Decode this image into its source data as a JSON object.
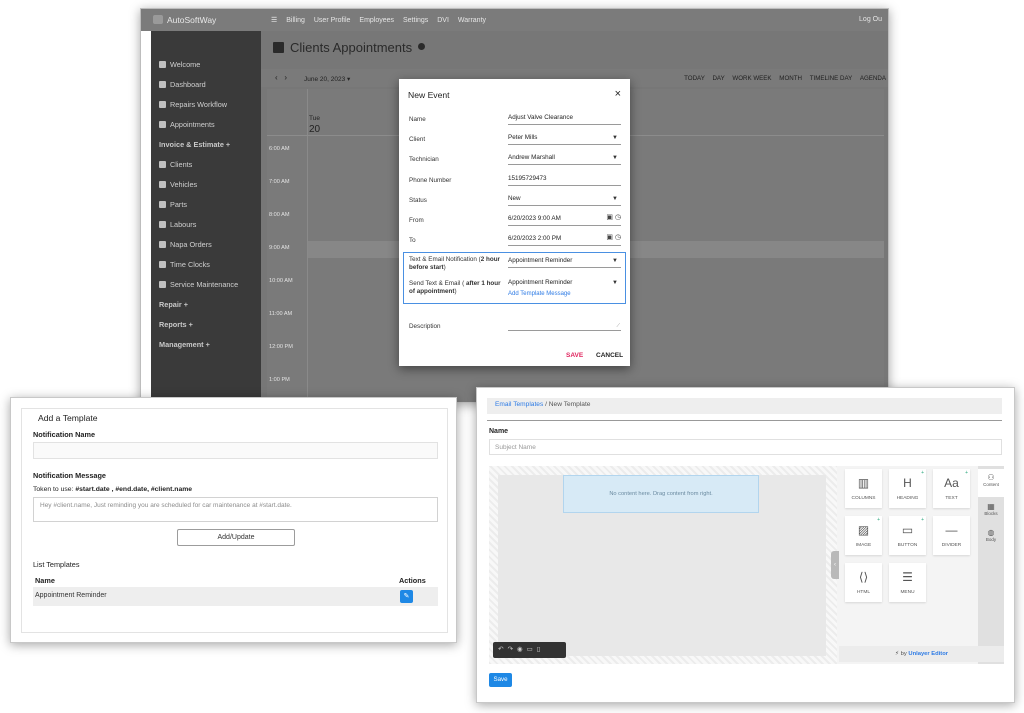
{
  "calendar_screen": {
    "brand": "AutoSoftWay",
    "top_nav": [
      "Billing",
      "User Profile",
      "Employees",
      "Settings",
      "DVI",
      "Warranty"
    ],
    "logout": "Log Ou",
    "sidebar": [
      "Welcome",
      "Dashboard",
      "Repairs Workflow",
      "Appointments",
      "Invoice & Estimate +",
      "Clients",
      "Vehicles",
      "Parts",
      "Labours",
      "Napa Orders",
      "Time Clocks",
      "Service Maintenance",
      "Repair +",
      "Reports +",
      "Management +"
    ],
    "page_title": "Clients Appointments",
    "nav_prev": "‹",
    "nav_next": "›",
    "date_selector": "June 20, 2023",
    "views": [
      "TODAY",
      "DAY",
      "WORK WEEK",
      "MONTH",
      "TIMELINE DAY",
      "AGENDA"
    ],
    "day_name": "Tue",
    "day_number": "20",
    "times": [
      "6:00 AM",
      "7:00 AM",
      "8:00 AM",
      "9:00 AM",
      "10:00 AM",
      "11:00 AM",
      "12:00 PM",
      "1:00 PM"
    ]
  },
  "new_event": {
    "title": "New Event",
    "close": "×",
    "fields": {
      "name": {
        "label": "Name",
        "value": "Adjust Valve Clearance"
      },
      "client": {
        "label": "Client",
        "value": "Peter Mills"
      },
      "technician": {
        "label": "Technician",
        "value": "Andrew Marshall"
      },
      "phone": {
        "label": "Phone Number",
        "value": "15195729473"
      },
      "status": {
        "label": "Status",
        "value": "New"
      },
      "from": {
        "label": "From",
        "value": "6/20/2023 9:00 AM"
      },
      "to": {
        "label": "To",
        "value": "6/20/2023 2:00 PM"
      },
      "notify": {
        "label_a": "Text & Email Notification (",
        "label_b": "2 hour before start",
        "label_c": ")",
        "value": "Appointment Reminder"
      },
      "send": {
        "label_a": "Send Text & Email ( ",
        "label_b": "after 1 hour of appointment",
        "label_c": ")",
        "value": "Appointment Reminder"
      },
      "description": {
        "label": "Description"
      }
    },
    "add_template_link": "Add Template Message",
    "save": "SAVE",
    "cancel": "CANCEL"
  },
  "add_template": {
    "title": "Add a Template",
    "notification_name_label": "Notification Name",
    "notification_message_label": "Notification Message",
    "token_text": "Token to use: ",
    "tokens": "#start.date , #end.date, #client.name",
    "message_placeholder": "Hey #client.name,  Just reminding you are scheduled for car maintenance at #start.date.",
    "add_update": "Add/Update",
    "list_title": "List Templates",
    "col_name": "Name",
    "col_actions": "Actions",
    "rows": [
      {
        "name": "Appointment Reminder"
      }
    ]
  },
  "email_templates": {
    "crumb_link": "Email Templates",
    "crumb_current": "New Template",
    "crumb_sep": "/",
    "name_label": "Name",
    "name_placeholder": "Subject Name",
    "drop_text": "No content here. Drag content from right.",
    "tools": [
      "COLUMNS",
      "HEADING",
      "TEXT",
      "IMAGE",
      "BUTTON",
      "DIVIDER",
      "HTML",
      "MENU"
    ],
    "tabs": [
      "Content",
      "Blocks",
      "Body"
    ],
    "byline_prefix": "⚡ by ",
    "byline_brand": "Unlayer Editor",
    "save": "Save"
  },
  "colors": {
    "accent": "#1e88e5",
    "save_red": "#e0245e",
    "highlight": "#4a90e2",
    "sidebar": "#3a3a3a"
  }
}
